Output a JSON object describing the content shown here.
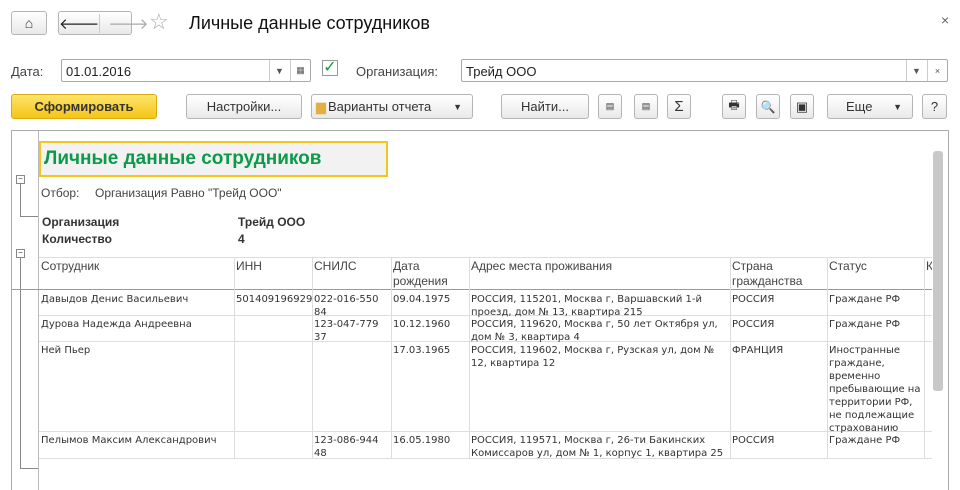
{
  "window": {
    "title": "Личные данные сотрудников",
    "close": "×"
  },
  "icons": {
    "home": "home-icon",
    "back": "arrow-left-icon",
    "forward": "arrow-right-icon",
    "favorite": "star-icon"
  },
  "filters": {
    "date_label": "Дата:",
    "date_value": "01.01.2016",
    "date_checked": true,
    "org_label": "Организация:",
    "org_value": "Трейд ООО"
  },
  "toolbar": {
    "generate": "Сформировать",
    "settings": "Настройки...",
    "variants": "Варианты отчета",
    "find": "Найти...",
    "more": "Еще",
    "help": "?",
    "sum": "Σ"
  },
  "colors": {
    "accent_yellow": "#f9d130",
    "title_green": "#0c9a4a"
  },
  "report": {
    "title": "Личные данные сотрудников",
    "filter_label": "Отбор:",
    "filter_value": "Организация Равно \"Трейд ООО\"",
    "group_org_label": "Организация",
    "group_org_value": "Трейд ООО",
    "count_label": "Количество",
    "count_value": "4",
    "columns": [
      "Сотрудник",
      "ИНН",
      "СНИЛС",
      "Дата рождения",
      "Адрес места проживания",
      "Страна гражданства",
      "Статус",
      "К"
    ],
    "rows": [
      {
        "name": "Давыдов Денис Васильевич",
        "inn": "501409196929",
        "snils": "022-016-550 84",
        "birth": "09.04.1975",
        "address": "РОССИЯ, 115201, Москва г, Варшавский 1-й проезд, дом № 13, квартира 215",
        "country": "РОССИЯ",
        "status": "Граждане РФ"
      },
      {
        "name": "Дурова Надежда Андреевна",
        "inn": "",
        "snils": "123-047-779 37",
        "birth": "10.12.1960",
        "address": "РОССИЯ, 119620, Москва г, 50 лет Октября ул, дом № 3, квартира 4",
        "country": "РОССИЯ",
        "status": "Граждане РФ"
      },
      {
        "name": "Ней Пьер",
        "inn": "",
        "snils": "",
        "birth": "17.03.1965",
        "address": "РОССИЯ, 119602, Москва г, Рузская ул, дом № 12, квартира 12",
        "country": "ФРАНЦИЯ",
        "status": "Иностранные граждане, временно пребывающие на территории РФ, не подлежащие страхованию"
      },
      {
        "name": "Пелымов Максим Александрович",
        "inn": "",
        "snils": "123-086-944 48",
        "birth": "16.05.1980",
        "address": "РОССИЯ, 119571, Москва г, 26-ти Бакинских Комиссаров ул, дом № 1, корпус 1, квартира 25",
        "country": "РОССИЯ",
        "status": "Граждане РФ"
      }
    ]
  }
}
